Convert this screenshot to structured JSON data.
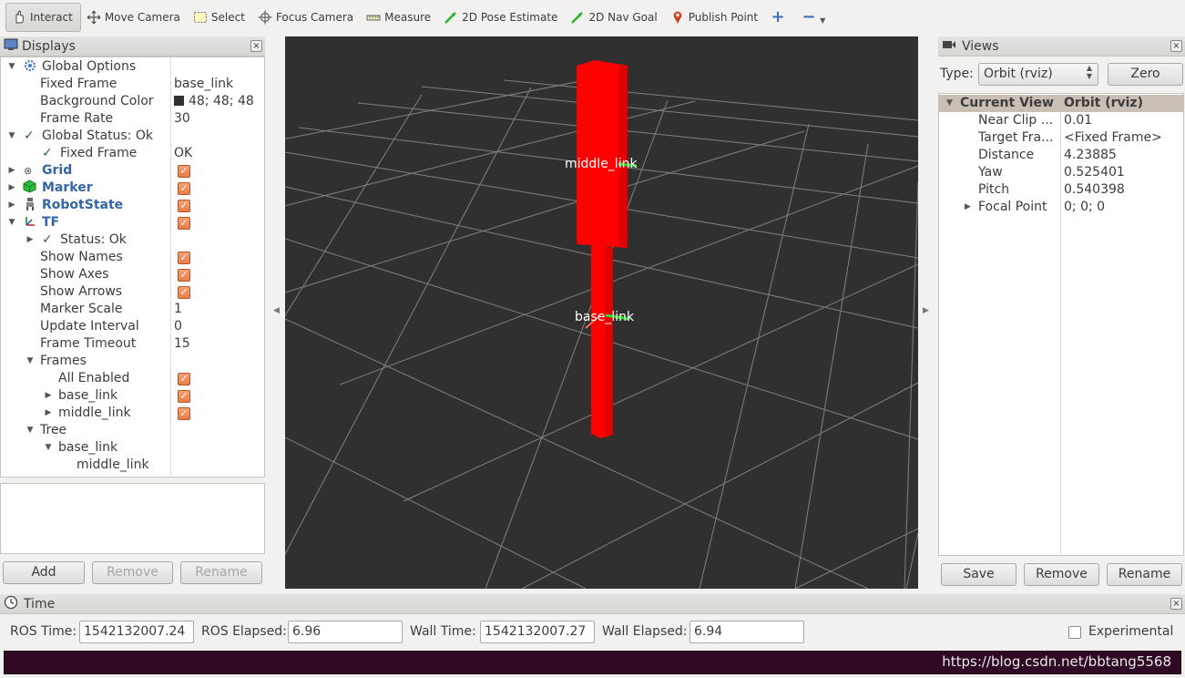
{
  "toolbar": {
    "tools": [
      {
        "label": "Interact",
        "icon": "hand-icon"
      },
      {
        "label": "Move Camera",
        "icon": "move-camera-icon"
      },
      {
        "label": "Select",
        "icon": "select-icon"
      },
      {
        "label": "Focus Camera",
        "icon": "focus-camera-icon"
      },
      {
        "label": "Measure",
        "icon": "measure-icon"
      },
      {
        "label": "2D Pose Estimate",
        "icon": "green-arrow-icon"
      },
      {
        "label": "2D Nav Goal",
        "icon": "green-arrow-icon"
      },
      {
        "label": "Publish Point",
        "icon": "map-pin-icon"
      }
    ],
    "active_tool": "Interact"
  },
  "displays": {
    "title": "Displays",
    "rows": {
      "global_options": "Global Options",
      "fixed_frame_label": "Fixed Frame",
      "fixed_frame_value": "base_link",
      "bg_color_label": "Background Color",
      "bg_color_value": "48; 48; 48",
      "frame_rate_label": "Frame Rate",
      "frame_rate_value": "30",
      "global_status": "Global Status: Ok",
      "gs_fixed_frame": "Fixed Frame",
      "gs_fixed_frame_value": "OK",
      "grid": "Grid",
      "marker": "Marker",
      "robot_state": "RobotState",
      "tf": "TF",
      "tf_status": "Status: Ok",
      "show_names": "Show Names",
      "show_axes": "Show Axes",
      "show_arrows": "Show Arrows",
      "marker_scale_label": "Marker Scale",
      "marker_scale_value": "1",
      "update_interval_label": "Update Interval",
      "update_interval_value": "0",
      "frame_timeout_label": "Frame Timeout",
      "frame_timeout_value": "15",
      "frames": "Frames",
      "all_enabled": "All Enabled",
      "frame_base_link": "base_link",
      "frame_middle_link": "middle_link",
      "tree": "Tree",
      "tree_base_link": "base_link",
      "tree_middle_link": "middle_link"
    },
    "buttons": {
      "add": "Add",
      "remove": "Remove",
      "rename": "Rename"
    }
  },
  "scene": {
    "label_middle": "middle_link",
    "label_base": "base_link",
    "background_color": "#303030",
    "marker_color": "#ff0000"
  },
  "views": {
    "title": "Views",
    "type_label": "Type:",
    "type_value": "Orbit (rviz)",
    "zero_button": "Zero",
    "header_name": "Current View",
    "header_value": "Orbit (rviz)",
    "props": [
      {
        "name": "Near Clip ...",
        "value": "0.01"
      },
      {
        "name": "Target Fra...",
        "value": "<Fixed Frame>"
      },
      {
        "name": "Distance",
        "value": "4.23885"
      },
      {
        "name": "Yaw",
        "value": "0.525401"
      },
      {
        "name": "Pitch",
        "value": "0.540398"
      },
      {
        "name": "Focal Point",
        "value": "0; 0; 0"
      }
    ],
    "buttons": {
      "save": "Save",
      "remove": "Remove",
      "rename": "Rename"
    }
  },
  "time": {
    "title": "Time",
    "ros_time_label": "ROS Time:",
    "ros_time_value": "1542132007.24",
    "ros_elapsed_label": "ROS Elapsed:",
    "ros_elapsed_value": "6.96",
    "wall_time_label": "Wall Time:",
    "wall_time_value": "1542132007.27",
    "wall_elapsed_label": "Wall Elapsed:",
    "wall_elapsed_value": "6.94",
    "experimental_label": "Experimental"
  },
  "watermark": "https://blog.csdn.net/bbtang5568"
}
